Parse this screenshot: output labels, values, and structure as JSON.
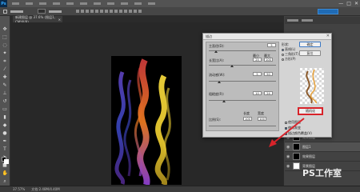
{
  "app": {
    "logo": "Ps",
    "window_controls": [
      "—",
      "□",
      "✕"
    ]
  },
  "document": {
    "tab_label": "新建图层 @ 37.6% (图层1, CMYK/8)",
    "tab_close": "✕"
  },
  "status": {
    "zoom": "37.57%",
    "doc_info": "文档:2.48M/4.40M"
  },
  "dialog": {
    "title": "描边",
    "close": "✕",
    "fields": [
      {
        "label": "主直径(D):",
        "value": "5"
      },
      {
        "label": "长宽比(A):",
        "min_label": "最小",
        "max_label": "最大",
        "min": "25",
        "max": "100"
      },
      {
        "label": "流动感(W):",
        "min": "5",
        "max": "50"
      },
      {
        "label": "粗糙度(R):",
        "min": "10",
        "max": "24"
      }
    ],
    "bottom_labels": [
      "比例(S):",
      "长度",
      "宽度"
    ],
    "bottom_values": [
      "100",
      "100"
    ],
    "radio_title": "形状:",
    "radio_options": [
      "直线(L)",
      "三角形(T)",
      "方形(P)"
    ],
    "ok_label": "确定",
    "reset_label": "复位",
    "random_label": "随机化",
    "options": [
      {
        "label": "使用图层",
        "checked": false
      },
      {
        "label": "使用渐变",
        "checked": true
      },
      {
        "label": "描边颜色覆盖(V)",
        "checked": true
      }
    ]
  },
  "layers": [
    {
      "name": "效果图层",
      "thumb": "dark",
      "active": false
    },
    {
      "name": "图层1",
      "thumb": "dark",
      "active": true
    },
    {
      "name": "效果图层",
      "thumb": "dark",
      "active": false
    },
    {
      "name": "背景图层",
      "thumb": "white",
      "active": false
    }
  ],
  "watermark": "PS工作室",
  "colors": {
    "accent_blue": "#1f6bb5",
    "highlight_red": "#d8232a",
    "ui_dark": "#2b2b2b"
  }
}
